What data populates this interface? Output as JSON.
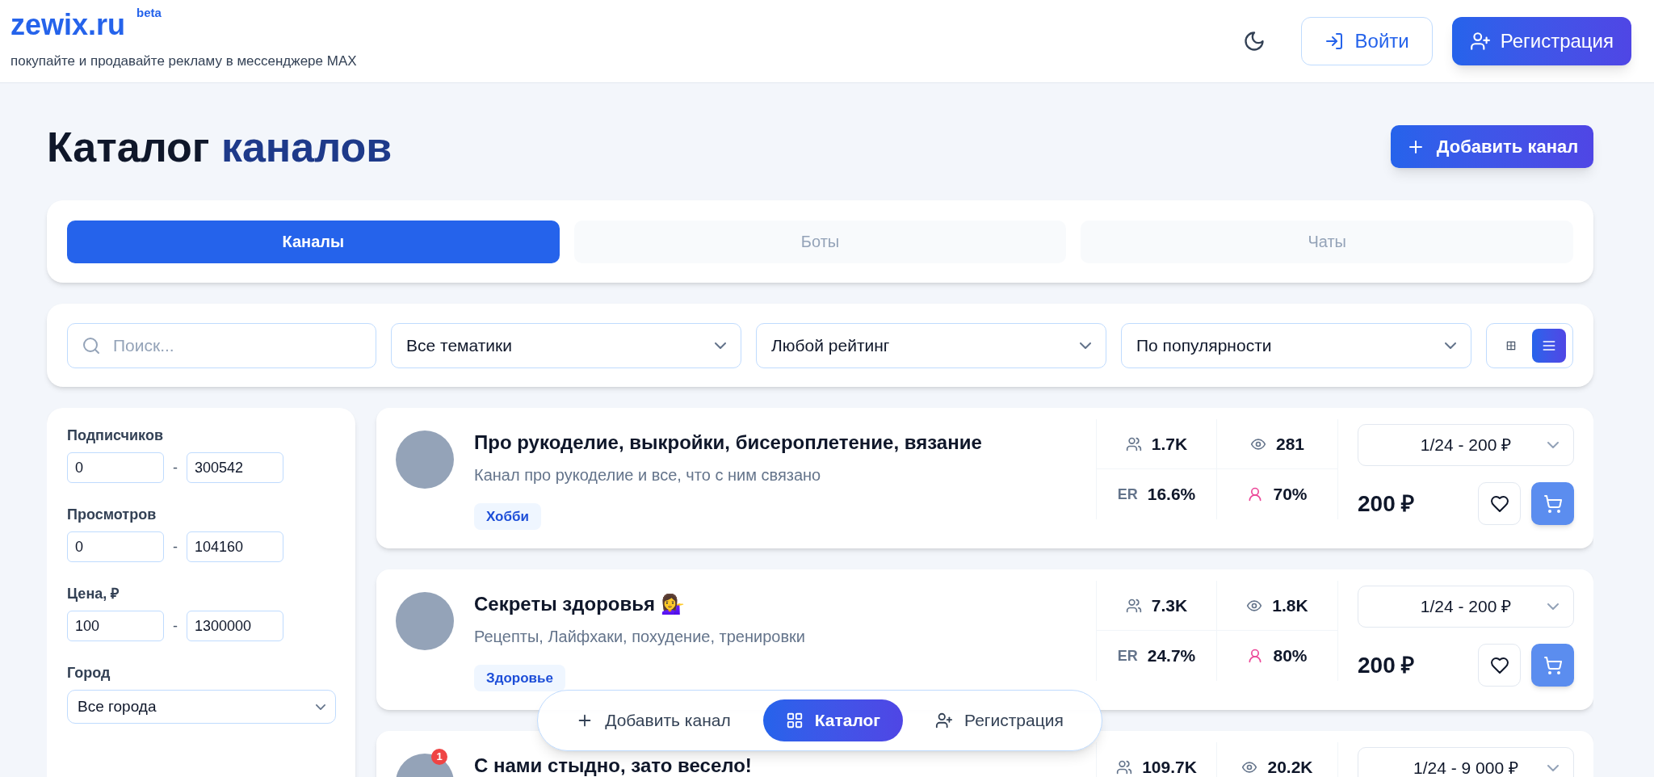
{
  "header": {
    "logo": "zewix.ru",
    "badge": "beta",
    "tagline": "покупайте и продавайте рекламу в мессенджере MAX",
    "buttons": [
      {
        "kind": "outline",
        "label": "Войти"
      },
      {
        "kind": "primary",
        "label": "Регистрация"
      }
    ]
  },
  "page": {
    "title": "Каталог",
    "title_accent": "каналов",
    "add_button": "Добавить канал"
  },
  "tabs": [
    {
      "label": "Каналы",
      "selected": true
    },
    {
      "label": "Боты",
      "selected": false
    },
    {
      "label": "Чаты",
      "selected": false
    }
  ],
  "filters": {
    "search": {
      "placeholder": "Поиск..."
    },
    "selects": [
      "Все тематики",
      "Любой рейтинг",
      "По популярности"
    ],
    "view_modes": [
      {
        "kind": "grid",
        "selected": false
      },
      {
        "kind": "list",
        "selected": true
      }
    ]
  },
  "sidebar": {
    "ranges": [
      {
        "label": "Подписчиков",
        "from": "0",
        "separator": "-",
        "to": "300542"
      },
      {
        "label": "Просмотров",
        "from": "0",
        "separator": "-",
        "to": "104160"
      },
      {
        "label": "Цена, ₽",
        "from": "100",
        "separator": "-",
        "to": "1300000"
      }
    ],
    "city": {
      "label": "Город",
      "value": "Все города"
    }
  },
  "channels": [
    {
      "title": "Про рукоделие, выкройки, бисероплетение, вязание",
      "description": "Канал про рукоделие и все, что с ним связано",
      "tag": "Хобби",
      "subscribers": "1.7K",
      "views": "281",
      "er_label": "ER",
      "er": "16.6%",
      "audience": "70%",
      "format": "1/24 - 200 ₽",
      "price": "200 ₽"
    },
    {
      "title": "Секреты здоровья 💁‍♀️",
      "description": "Рецепты, Лайфхаки, похудение, тренировки",
      "tag": "Здоровье",
      "subscribers": "7.3K",
      "views": "1.8K",
      "er_label": "ER",
      "er": "24.7%",
      "audience": "80%",
      "format": "1/24 - 200 ₽",
      "price": "200 ₽"
    },
    {
      "title": "С нами стыдно, зато весело!",
      "badge": "1",
      "subscribers": "109.7K",
      "views": "20.2K",
      "format": "1/24 - 9 000 ₽"
    }
  ],
  "bottom_nav": [
    {
      "kind": "add",
      "label": "Добавить канал",
      "selected": false
    },
    {
      "kind": "catalog",
      "label": "Каталог",
      "selected": true
    },
    {
      "kind": "register",
      "label": "Регистрация",
      "selected": false
    }
  ]
}
